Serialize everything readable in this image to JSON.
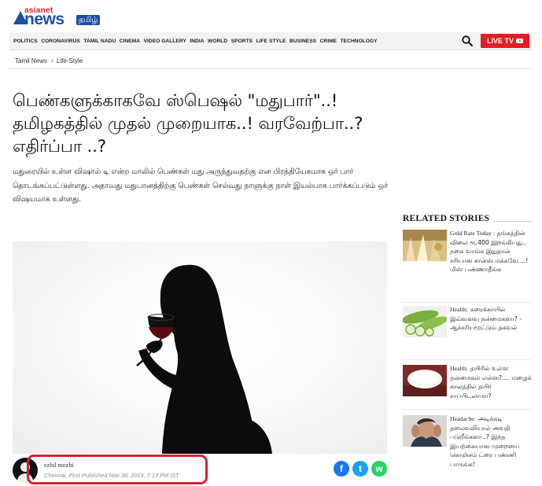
{
  "brand": {
    "asianet": "asianet",
    "news": "news",
    "lang": "தமிழ்",
    "color": "#1d4fa5",
    "accent": "#e41d24"
  },
  "nav": {
    "items": [
      "POLITICS",
      "CORONAVIRUS",
      "TAMIL NADU",
      "CINEMA",
      "VIDEO GALLERY",
      "INDIA",
      "WORLD",
      "SPORTS",
      "LIFE STYLE",
      "BUSINESS",
      "CRIME",
      "TECHNOLOGY"
    ],
    "search_icon": "search-icon",
    "live_tv": "LIVE TV"
  },
  "breadcrumb": {
    "home": "Tamil News",
    "section": "Life-Style"
  },
  "article": {
    "title": "பெண்களுக்காகவே ஸ்பெஷல் \"மதுபார்\"..! தமிழகத்தில் முதல் முறையாக..! வரவேற்பா..? எதிர்ப்பா ..?",
    "summary": "மதுரையில் உள்ள விஷால் டி என்ற மாலில் பெண்கள் மது அருந்துவதற்கு என பிரத்தியேகமாக ஒர் பார் தொடங்கப்பட்டுள்ளது. அதாவது மதுபானத்திற்கு பெண்கள் செல்வது நாளுக்கு நாள் இயல்பாக பார்க்கப்படும் ஒர் விஷயமாக உள்ளது.",
    "image_alt": "woman drinking wine silhouette",
    "author": "ezhil mozhi",
    "meta": "Chennai, First Published Nov 30, 2019, 7:13 PM IST",
    "share": [
      {
        "name": "facebook",
        "glyph": "f",
        "color": "#1877f2"
      },
      {
        "name": "twitter",
        "glyph": "t",
        "color": "#1da1f2"
      },
      {
        "name": "whatsapp",
        "glyph": "w",
        "color": "#25d366"
      }
    ]
  },
  "related": {
    "title": "RELATED STORIES",
    "stories": [
      {
        "prefix": "Gold Rate Today :",
        "text": "தங்கத்தின் விலை ரூ.400 இறங்கியது.. நகை வாங்க இதுதான் சரியான சான்ஸ் மக்களே....! மிஸ் பண்ணாதீங்க"
      },
      {
        "prefix": "Health:",
        "text": "சுரைக்காயில் இவ்வளவு நன்மைகளா? - ஆச்சரியமூட்டும் தகவல்"
      },
      {
        "prefix": "Health:",
        "text": "தயிரில் உள்ள நன்மைகள் என்ன?.... மழைக் காலத்தில் தயிர் சாப்பிடலாமா?"
      },
      {
        "prefix": "Headache:",
        "text": "அடிக்கடி தலைவலியால் அவதி படுறீங்களா..? இந்த இயற்கையான முறையை கொஞ்சம் ட்ரை பண்ணி பாருங்க!"
      }
    ]
  }
}
